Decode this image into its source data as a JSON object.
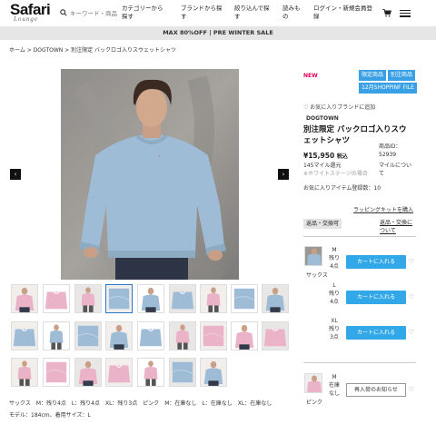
{
  "header": {
    "logo": "Safari",
    "logo_sub": "Lounge",
    "search_placeholder": "キーワード・商品",
    "nav": [
      "カテゴリーから探す",
      "ブランドから探す",
      "絞り込んで探す",
      "読みもの",
      "ログイン・新規会員登録"
    ]
  },
  "banner": "MAX 80%OFF | PRE WINTER SALE",
  "breadcrumb": "ホーム > DOGTOWN > 別注限定 バックロゴ入りスウェットシャツ",
  "gallery": {
    "prev": "‹",
    "next": "›",
    "size_info": "サックス　M：残り4点　L：残り4点　XL：残り3点　ピンク　M：在庫なし　L：在庫なし　XL：在庫なし",
    "model_info": "モデル：184cm、着用サイズ：L"
  },
  "product": {
    "tag_new": "NEW",
    "badges": [
      "限定商品",
      "別注商品",
      "12月SHOPPINF FILE"
    ],
    "fav_brand": "お気に入りブランドに追加",
    "brand": "DOGTOWN",
    "name": "別注限定 バックロゴ入りスウェットシャツ",
    "price": "¥15,950",
    "price_suffix": "税込",
    "mile": "145マイル還元",
    "mile_note": "※ホワイトステージの場合",
    "id_label": "商品ID：",
    "id_value": "52939",
    "mile_link": "マイルについて",
    "fav_count_label": "お気に入りアイテム登録数：",
    "fav_count": "10",
    "wrapping": "ラッピングキットを購入",
    "tab_return": "返品・交換可",
    "tab_about": "返品・交換について"
  },
  "variants": [
    {
      "name": "サックス",
      "sizes": [
        {
          "size": "M",
          "stock": "残り4点",
          "button": "カートに入れる"
        },
        {
          "size": "L",
          "stock": "残り4点",
          "button": "カートに入れる"
        },
        {
          "size": "XL",
          "stock": "残り3点",
          "button": "カートに入れる"
        }
      ]
    },
    {
      "name": "ピンク",
      "sizes": [
        {
          "size": "M",
          "stock": "在庫なし",
          "button": "再入荷のお知らせ"
        }
      ]
    }
  ],
  "colors": {
    "accent": "#33a8e8",
    "new": "#e6005c",
    "badge": "#3aa0e6",
    "blue_sweat": "#9fbcd6",
    "pink_sweat": "#eab3c8"
  }
}
